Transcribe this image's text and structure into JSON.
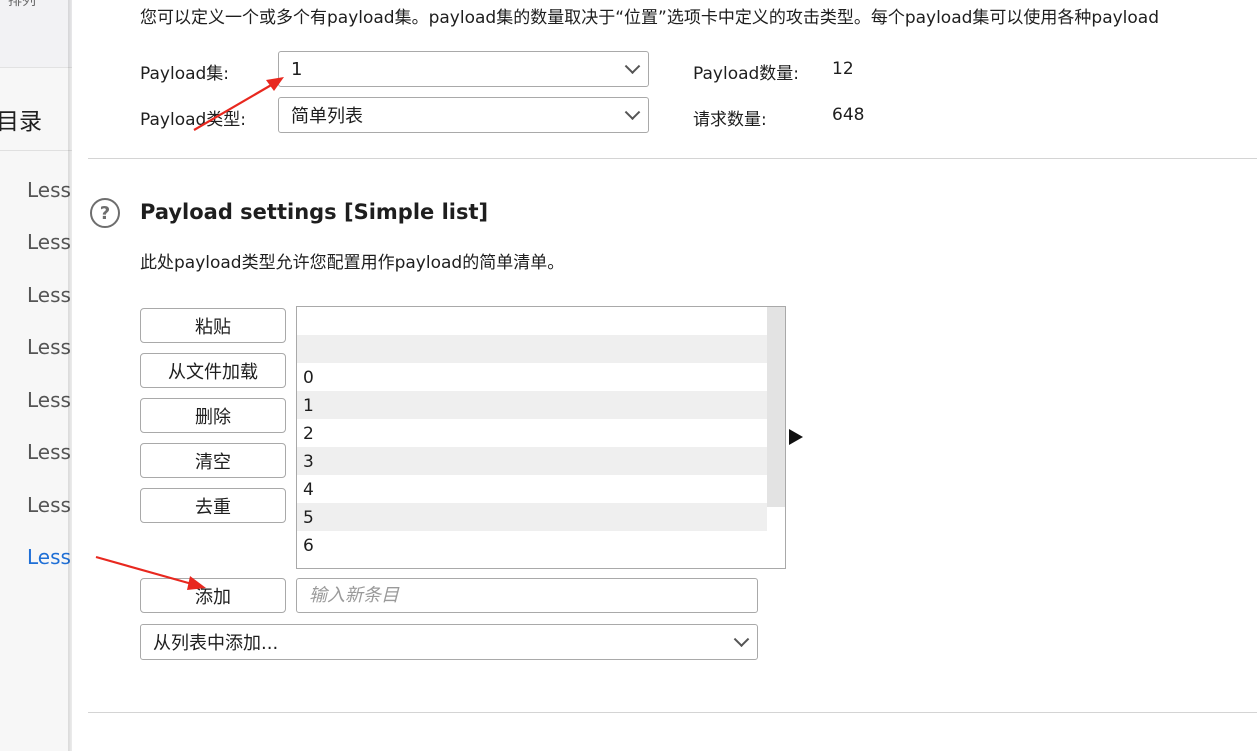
{
  "left_panel": {
    "top_text": "排列",
    "heading": "目录",
    "lessons": [
      "Less",
      "Less",
      "Less",
      "Less",
      "Less",
      "Less",
      "Less",
      "Less"
    ],
    "active_lesson_index": 7
  },
  "payload_sets": {
    "description": "您可以定义一个或多个有payload集。payload集的数量取决于“位置”选项卡中定义的攻击类型。每个payload集可以使用各种payload",
    "set_label": "Payload集:",
    "set_value": "1",
    "type_label": "Payload类型:",
    "type_value": "简单列表",
    "count_label": "Payload数量:",
    "count_value": "12",
    "requests_label": "请求数量:",
    "requests_value": "648"
  },
  "payload_settings": {
    "title": "Payload settings [Simple list]",
    "description": "此处payload类型允许您配置用作payload的简单清单。",
    "buttons": {
      "paste": "粘贴",
      "load": "从文件加载",
      "remove": "删除",
      "clear": "清空",
      "dedupe": "去重",
      "add": "添加"
    },
    "list_items": [
      "",
      "",
      "0",
      "1",
      "2",
      "3",
      "4",
      "5",
      "6"
    ],
    "new_entry_placeholder": "输入新条目",
    "add_from_list": "从列表中添加..."
  },
  "colors": {
    "annotation_arrow": "#e8281f",
    "active_link": "#1f6fd6"
  }
}
